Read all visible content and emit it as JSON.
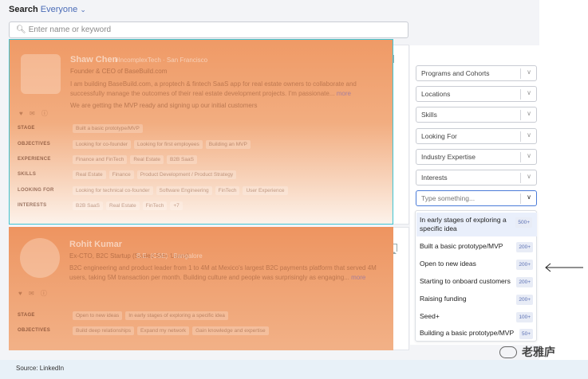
{
  "search": {
    "label": "Search",
    "scope": "Everyone",
    "placeholder": "Enter name or keyword"
  },
  "profiles": [
    {
      "name": "Shaw Chen",
      "meta": "#IncomplexTech  · San Francisco",
      "title": "Founder & CEO of BaseBuild.com",
      "bio": "I am building BaseBuild.com, a proptech & fintech SaaS app for real estate owners to collaborate and successfully manage the outcomes of their real estate development projects. I'm passionate...",
      "more": "more",
      "status": "We are getting the MVP ready and signing up our initial customers",
      "rows": [
        {
          "label": "STAGE",
          "chips": [
            "Built a basic prototype/MVP"
          ]
        },
        {
          "label": "OBJECTIVES",
          "chips": [
            "Looking for co-founder",
            "Looking for first employees",
            "Building an MVP"
          ]
        },
        {
          "label": "EXPERIENCE",
          "chips": [
            "Finance and FinTech",
            "Real Estate",
            "B2B SaaS"
          ]
        },
        {
          "label": "SKILLS",
          "chips": [
            "Real Estate",
            "Finance",
            "Product Development / Product Strategy"
          ]
        },
        {
          "label": "LOOKING FOR",
          "chips": [
            "Looking for technical co-founder",
            "Software Engineering",
            "FinTech",
            "User Experience"
          ]
        },
        {
          "label": "INTERESTS",
          "chips": [
            "B2B SaaS",
            "Real Estate",
            "FinTech",
            "+7"
          ]
        }
      ]
    },
    {
      "name": "Rohit Kumar",
      "meta": "B.E. (CSE) · Bangalore",
      "title": "Ex-CTO, B2C Startup (Scaled 5M+ Users)",
      "bio": "B2C engineering and product leader from 1 to 4M at Mexico's largest B2C payments platform that served 4M users, taking 5M transaction per month. Building culture and people was surprisingly as engaging...",
      "more": "more",
      "rows": [
        {
          "label": "STAGE",
          "chips": [
            "Open to new ideas",
            "In early stages of exploring a specific idea"
          ]
        },
        {
          "label": "OBJECTIVES",
          "chips": [
            "Build deep relationships",
            "Expand my network",
            "Gain knowledge and expertise"
          ]
        }
      ]
    }
  ],
  "filters": [
    "Programs and Cohorts",
    "Locations",
    "Skills",
    "Looking For",
    "Industry Expertise",
    "Interests"
  ],
  "filter_input_placeholder": "Type something...",
  "dropdown": [
    {
      "label": "In early stages of exploring a specific idea",
      "count": "500+"
    },
    {
      "label": "Built a basic prototype/MVP",
      "count": "200+"
    },
    {
      "label": "Open to new ideas",
      "count": "200+"
    },
    {
      "label": "Starting to onboard customers",
      "count": "200+"
    },
    {
      "label": "Raising funding",
      "count": "200+"
    },
    {
      "label": "Seed+",
      "count": "100+"
    },
    {
      "label": "Building a basic prototype/MVP",
      "count": "50+"
    }
  ],
  "watermark": "老雅庐",
  "footer": "Source: LinkedIn",
  "colors": {
    "overlay": "#ef9a66",
    "accent": "#4a7bd8",
    "footer_bg": "#e8f1f8"
  }
}
